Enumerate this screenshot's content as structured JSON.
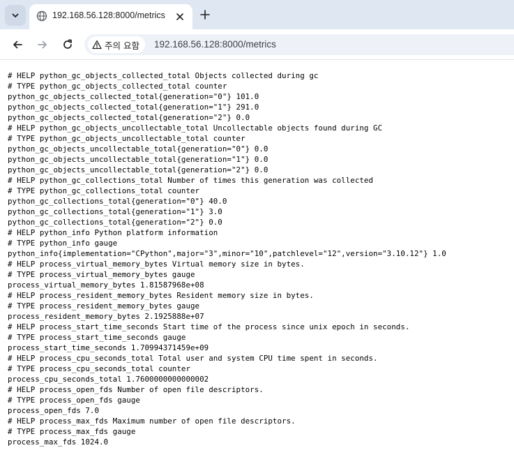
{
  "browser": {
    "tab": {
      "title": "192.168.56.128:8000/metrics"
    },
    "toolbar": {
      "security_label": "주의 요함",
      "url": "192.168.56.128:8000/metrics"
    }
  },
  "icons": [
    "chevron-down-icon",
    "globe-icon",
    "close-icon",
    "plus-icon",
    "back-arrow-icon",
    "forward-arrow-icon",
    "reload-icon",
    "warning-triangle-icon"
  ],
  "page": {
    "lines": [
      "# HELP python_gc_objects_collected_total Objects collected during gc",
      "# TYPE python_gc_objects_collected_total counter",
      "python_gc_objects_collected_total{generation=\"0\"} 101.0",
      "python_gc_objects_collected_total{generation=\"1\"} 291.0",
      "python_gc_objects_collected_total{generation=\"2\"} 0.0",
      "# HELP python_gc_objects_uncollectable_total Uncollectable objects found during GC",
      "# TYPE python_gc_objects_uncollectable_total counter",
      "python_gc_objects_uncollectable_total{generation=\"0\"} 0.0",
      "python_gc_objects_uncollectable_total{generation=\"1\"} 0.0",
      "python_gc_objects_uncollectable_total{generation=\"2\"} 0.0",
      "# HELP python_gc_collections_total Number of times this generation was collected",
      "# TYPE python_gc_collections_total counter",
      "python_gc_collections_total{generation=\"0\"} 40.0",
      "python_gc_collections_total{generation=\"1\"} 3.0",
      "python_gc_collections_total{generation=\"2\"} 0.0",
      "# HELP python_info Python platform information",
      "# TYPE python_info gauge",
      "python_info{implementation=\"CPython\",major=\"3\",minor=\"10\",patchlevel=\"12\",version=\"3.10.12\"} 1.0",
      "# HELP process_virtual_memory_bytes Virtual memory size in bytes.",
      "# TYPE process_virtual_memory_bytes gauge",
      "process_virtual_memory_bytes 1.81587968e+08",
      "# HELP process_resident_memory_bytes Resident memory size in bytes.",
      "# TYPE process_resident_memory_bytes gauge",
      "process_resident_memory_bytes 2.1925888e+07",
      "# HELP process_start_time_seconds Start time of the process since unix epoch in seconds.",
      "# TYPE process_start_time_seconds gauge",
      "process_start_time_seconds 1.70994371459e+09",
      "# HELP process_cpu_seconds_total Total user and system CPU time spent in seconds.",
      "# TYPE process_cpu_seconds_total counter",
      "process_cpu_seconds_total 1.7600000000000002",
      "# HELP process_open_fds Number of open file descriptors.",
      "# TYPE process_open_fds gauge",
      "process_open_fds 7.0",
      "# HELP process_max_fds Maximum number of open file descriptors.",
      "# TYPE process_max_fds gauge",
      "process_max_fds 1024.0"
    ]
  }
}
